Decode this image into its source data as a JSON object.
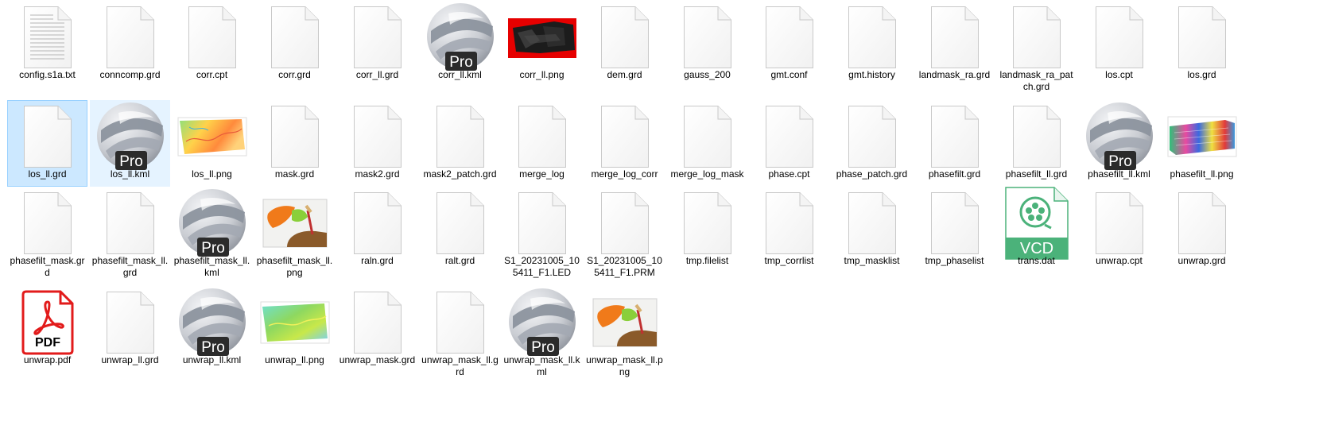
{
  "window": {
    "view": "Large icons"
  },
  "colors": {
    "selection_background": "#cce8ff",
    "selection_border": "#99d1ff",
    "hover_background": "#e5f3ff",
    "pdf_red": "#e21b1b",
    "vcd_green": "#4bb27a",
    "corr_red": "#e60000"
  },
  "files": [
    {
      "name": "config.s1a.txt",
      "icon": "text-file-icon"
    },
    {
      "name": "conncomp.grd",
      "icon": "blank-file-icon"
    },
    {
      "name": "corr.cpt",
      "icon": "blank-file-icon"
    },
    {
      "name": "corr.grd",
      "icon": "blank-file-icon"
    },
    {
      "name": "corr_ll.grd",
      "icon": "blank-file-icon"
    },
    {
      "name": "corr_ll.kml",
      "icon": "google-earth-pro-icon",
      "badge": "Pro"
    },
    {
      "name": "corr_ll.png",
      "icon": "image-thumbnail-corr"
    },
    {
      "name": "dem.grd",
      "icon": "blank-file-icon"
    },
    {
      "name": "gauss_200",
      "icon": "blank-file-icon"
    },
    {
      "name": "gmt.conf",
      "icon": "blank-file-icon"
    },
    {
      "name": "gmt.history",
      "icon": "blank-file-icon"
    },
    {
      "name": "landmask_ra.grd",
      "icon": "blank-file-icon"
    },
    {
      "name": "landmask_ra_patch.grd",
      "icon": "blank-file-icon"
    },
    {
      "name": "los.cpt",
      "icon": "blank-file-icon"
    },
    {
      "name": "los.grd",
      "icon": "blank-file-icon"
    },
    {
      "name": "los_ll.grd",
      "icon": "blank-file-icon",
      "state": "selected"
    },
    {
      "name": "los_ll.kml",
      "icon": "google-earth-pro-icon",
      "badge": "Pro",
      "state": "hovered"
    },
    {
      "name": "los_ll.png",
      "icon": "image-thumbnail-los"
    },
    {
      "name": "mask.grd",
      "icon": "blank-file-icon"
    },
    {
      "name": "mask2.grd",
      "icon": "blank-file-icon"
    },
    {
      "name": "mask2_patch.grd",
      "icon": "blank-file-icon"
    },
    {
      "name": "merge_log",
      "icon": "blank-file-icon"
    },
    {
      "name": "merge_log_corr",
      "icon": "blank-file-icon"
    },
    {
      "name": "merge_log_mask",
      "icon": "blank-file-icon"
    },
    {
      "name": "phase.cpt",
      "icon": "blank-file-icon"
    },
    {
      "name": "phase_patch.grd",
      "icon": "blank-file-icon"
    },
    {
      "name": "phasefilt.grd",
      "icon": "blank-file-icon"
    },
    {
      "name": "phasefilt_ll.grd",
      "icon": "blank-file-icon"
    },
    {
      "name": "phasefilt_ll.kml",
      "icon": "google-earth-pro-icon",
      "badge": "Pro"
    },
    {
      "name": "phasefilt_ll.png",
      "icon": "image-thumbnail-phase"
    },
    {
      "name": "phasefilt_mask.grd",
      "icon": "blank-file-icon"
    },
    {
      "name": "phasefilt_mask_ll.grd",
      "icon": "blank-file-icon"
    },
    {
      "name": "phasefilt_mask_ll.kml",
      "icon": "google-earth-pro-icon",
      "badge": "Pro"
    },
    {
      "name": "phasefilt_mask_ll.png",
      "icon": "image-thumbnail-paint"
    },
    {
      "name": "raln.grd",
      "icon": "blank-file-icon"
    },
    {
      "name": "ralt.grd",
      "icon": "blank-file-icon"
    },
    {
      "name": "S1_20231005_105411_F1.LED",
      "icon": "blank-file-icon"
    },
    {
      "name": "S1_20231005_105411_F1.PRM",
      "icon": "blank-file-icon"
    },
    {
      "name": "tmp.filelist",
      "icon": "blank-file-icon"
    },
    {
      "name": "tmp_corrlist",
      "icon": "blank-file-icon"
    },
    {
      "name": "tmp_masklist",
      "icon": "blank-file-icon"
    },
    {
      "name": "tmp_phaselist",
      "icon": "blank-file-icon"
    },
    {
      "name": "trans.dat",
      "icon": "vcd-file-icon",
      "badge": "VCD"
    },
    {
      "name": "unwrap.cpt",
      "icon": "blank-file-icon"
    },
    {
      "name": "unwrap.grd",
      "icon": "blank-file-icon"
    },
    {
      "name": "unwrap.pdf",
      "icon": "pdf-file-icon",
      "badge": "PDF"
    },
    {
      "name": "unwrap_ll.grd",
      "icon": "blank-file-icon"
    },
    {
      "name": "unwrap_ll.kml",
      "icon": "google-earth-pro-icon",
      "badge": "Pro"
    },
    {
      "name": "unwrap_ll.png",
      "icon": "image-thumbnail-unwrap"
    },
    {
      "name": "unwrap_mask.grd",
      "icon": "blank-file-icon"
    },
    {
      "name": "unwrap_mask_ll.grd",
      "icon": "blank-file-icon"
    },
    {
      "name": "unwrap_mask_ll.kml",
      "icon": "google-earth-pro-icon",
      "badge": "Pro"
    },
    {
      "name": "unwrap_mask_ll.png",
      "icon": "image-thumbnail-paint"
    }
  ]
}
